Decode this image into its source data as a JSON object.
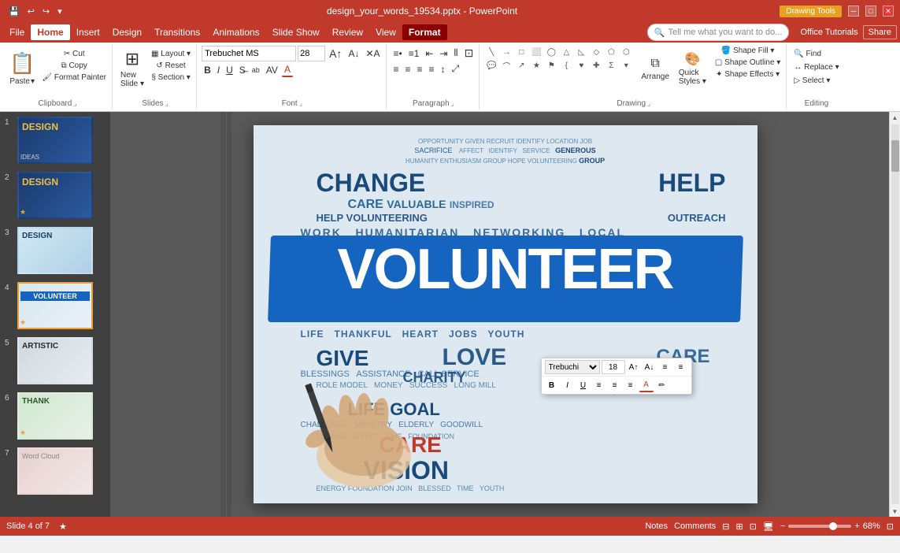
{
  "titleBar": {
    "title": "design_your_words_19534.pptx - PowerPoint",
    "quickAccess": [
      "💾",
      "↩",
      "↪",
      "⚡"
    ],
    "windowControls": [
      "─",
      "□",
      "✕"
    ],
    "drawingTools": "Drawing Tools"
  },
  "menuBar": {
    "items": [
      {
        "label": "File",
        "active": false
      },
      {
        "label": "Home",
        "active": true
      },
      {
        "label": "Insert",
        "active": false
      },
      {
        "label": "Design",
        "active": false
      },
      {
        "label": "Transitions",
        "active": false
      },
      {
        "label": "Animations",
        "active": false
      },
      {
        "label": "Slide Show",
        "active": false
      },
      {
        "label": "Review",
        "active": false
      },
      {
        "label": "View",
        "active": false
      },
      {
        "label": "Format",
        "active": false,
        "contextual": true
      }
    ],
    "tellMe": "Tell me what you want to do...",
    "officeLink": "Office Tutorials",
    "shareBtn": "Share"
  },
  "ribbon": {
    "groups": [
      {
        "name": "Clipboard",
        "buttons": [
          {
            "label": "Paste",
            "icon": "📋",
            "large": true
          },
          {
            "label": "Cut",
            "icon": "✂"
          },
          {
            "label": "Copy",
            "icon": "⧉"
          },
          {
            "label": "Format Painter",
            "icon": "🖌"
          }
        ]
      },
      {
        "name": "Slides",
        "buttons": [
          {
            "label": "New Slide",
            "icon": "⊞"
          },
          {
            "label": "Layout",
            "icon": "▦"
          },
          {
            "label": "Reset",
            "icon": "↺"
          },
          {
            "label": "Section",
            "icon": "§"
          }
        ]
      },
      {
        "name": "Font",
        "fontName": "Trebuchet MS",
        "fontSize": "28",
        "formatBtns": [
          "B",
          "I",
          "U",
          "S",
          "ab",
          "A",
          "A"
        ]
      },
      {
        "name": "Paragraph",
        "alignBtns": [
          "≡",
          "≡",
          "≡",
          "≡",
          "≡"
        ],
        "listBtns": [
          "☰",
          "☰",
          "☰",
          "☰"
        ],
        "indent": [
          "↓",
          "↑"
        ]
      },
      {
        "name": "Drawing",
        "shapes": [
          "╲",
          "□",
          "◯",
          "△",
          "→",
          "⟨",
          "⌀",
          "◇",
          "⌒",
          "⌓",
          "⌕",
          "⌖",
          "♦",
          "⊕",
          "⊗",
          "⊘"
        ],
        "buttons": [
          {
            "label": "Arrange",
            "icon": "⧉"
          },
          {
            "label": "Quick Styles",
            "icon": "🎨"
          },
          {
            "label": "Shape Fill",
            "icon": "🪣"
          },
          {
            "label": "Shape Outline",
            "icon": "▢"
          },
          {
            "label": "Shape Effects",
            "icon": "✦"
          }
        ]
      },
      {
        "name": "Editing",
        "buttons": [
          {
            "label": "Find",
            "icon": "🔍"
          },
          {
            "label": "Replace",
            "icon": "↔"
          },
          {
            "label": "Select",
            "icon": "▷"
          }
        ]
      }
    ]
  },
  "slides": [
    {
      "num": "1",
      "star": false,
      "bg": "slide-1-bg",
      "text": "DESIGN"
    },
    {
      "num": "2",
      "star": true,
      "bg": "slide-2-bg",
      "text": "DESIGN"
    },
    {
      "num": "3",
      "star": false,
      "bg": "slide-3-bg",
      "text": "DESIGN"
    },
    {
      "num": "4",
      "star": true,
      "bg": "slide-4-bg",
      "text": "VOLUNTEER",
      "active": true
    },
    {
      "num": "5",
      "star": false,
      "bg": "slide-5-bg",
      "text": "ARTISTIC"
    },
    {
      "num": "6",
      "star": true,
      "bg": "slide-6-bg",
      "text": "THANK"
    },
    {
      "num": "7",
      "star": false,
      "bg": "slide-7-bg",
      "text": "..."
    }
  ],
  "mainSlide": {
    "words": {
      "topWords": [
        "SACRIFICE",
        "CHANGE",
        "HELP",
        "CARE",
        "VALUABLE",
        "INSPIRED",
        "OUTREACH",
        "NETWORKING",
        "LOCAL",
        "WORK",
        "HUMANITARIAN"
      ],
      "mainWord": "VOLUNTEER",
      "bottomWords": [
        "GIVE",
        "LOVE",
        "CARE",
        "CHARITY",
        "LIFE",
        "GOAL",
        "VISION",
        "CARE",
        "THANKFUL",
        "HEART",
        "JOBS",
        "YOUTH",
        "BLESSINGS",
        "ASSISTANCE",
        "MONEY"
      ],
      "redWord": "CARE"
    }
  },
  "miniToolbar": {
    "fontName": "Trebuchi",
    "buttons": [
      "A+",
      "A-",
      "≡",
      "≡"
    ],
    "formatBtns": [
      "B",
      "I",
      "U",
      "A",
      "✏"
    ]
  },
  "statusBar": {
    "slideInfo": "Slide 4 of 7",
    "starIcon": "★",
    "notesLabel": "Notes",
    "commentsLabel": "Comments",
    "viewBtns": [
      "⊟",
      "⊞",
      "⊡",
      "🖥"
    ],
    "zoom": "68%"
  }
}
